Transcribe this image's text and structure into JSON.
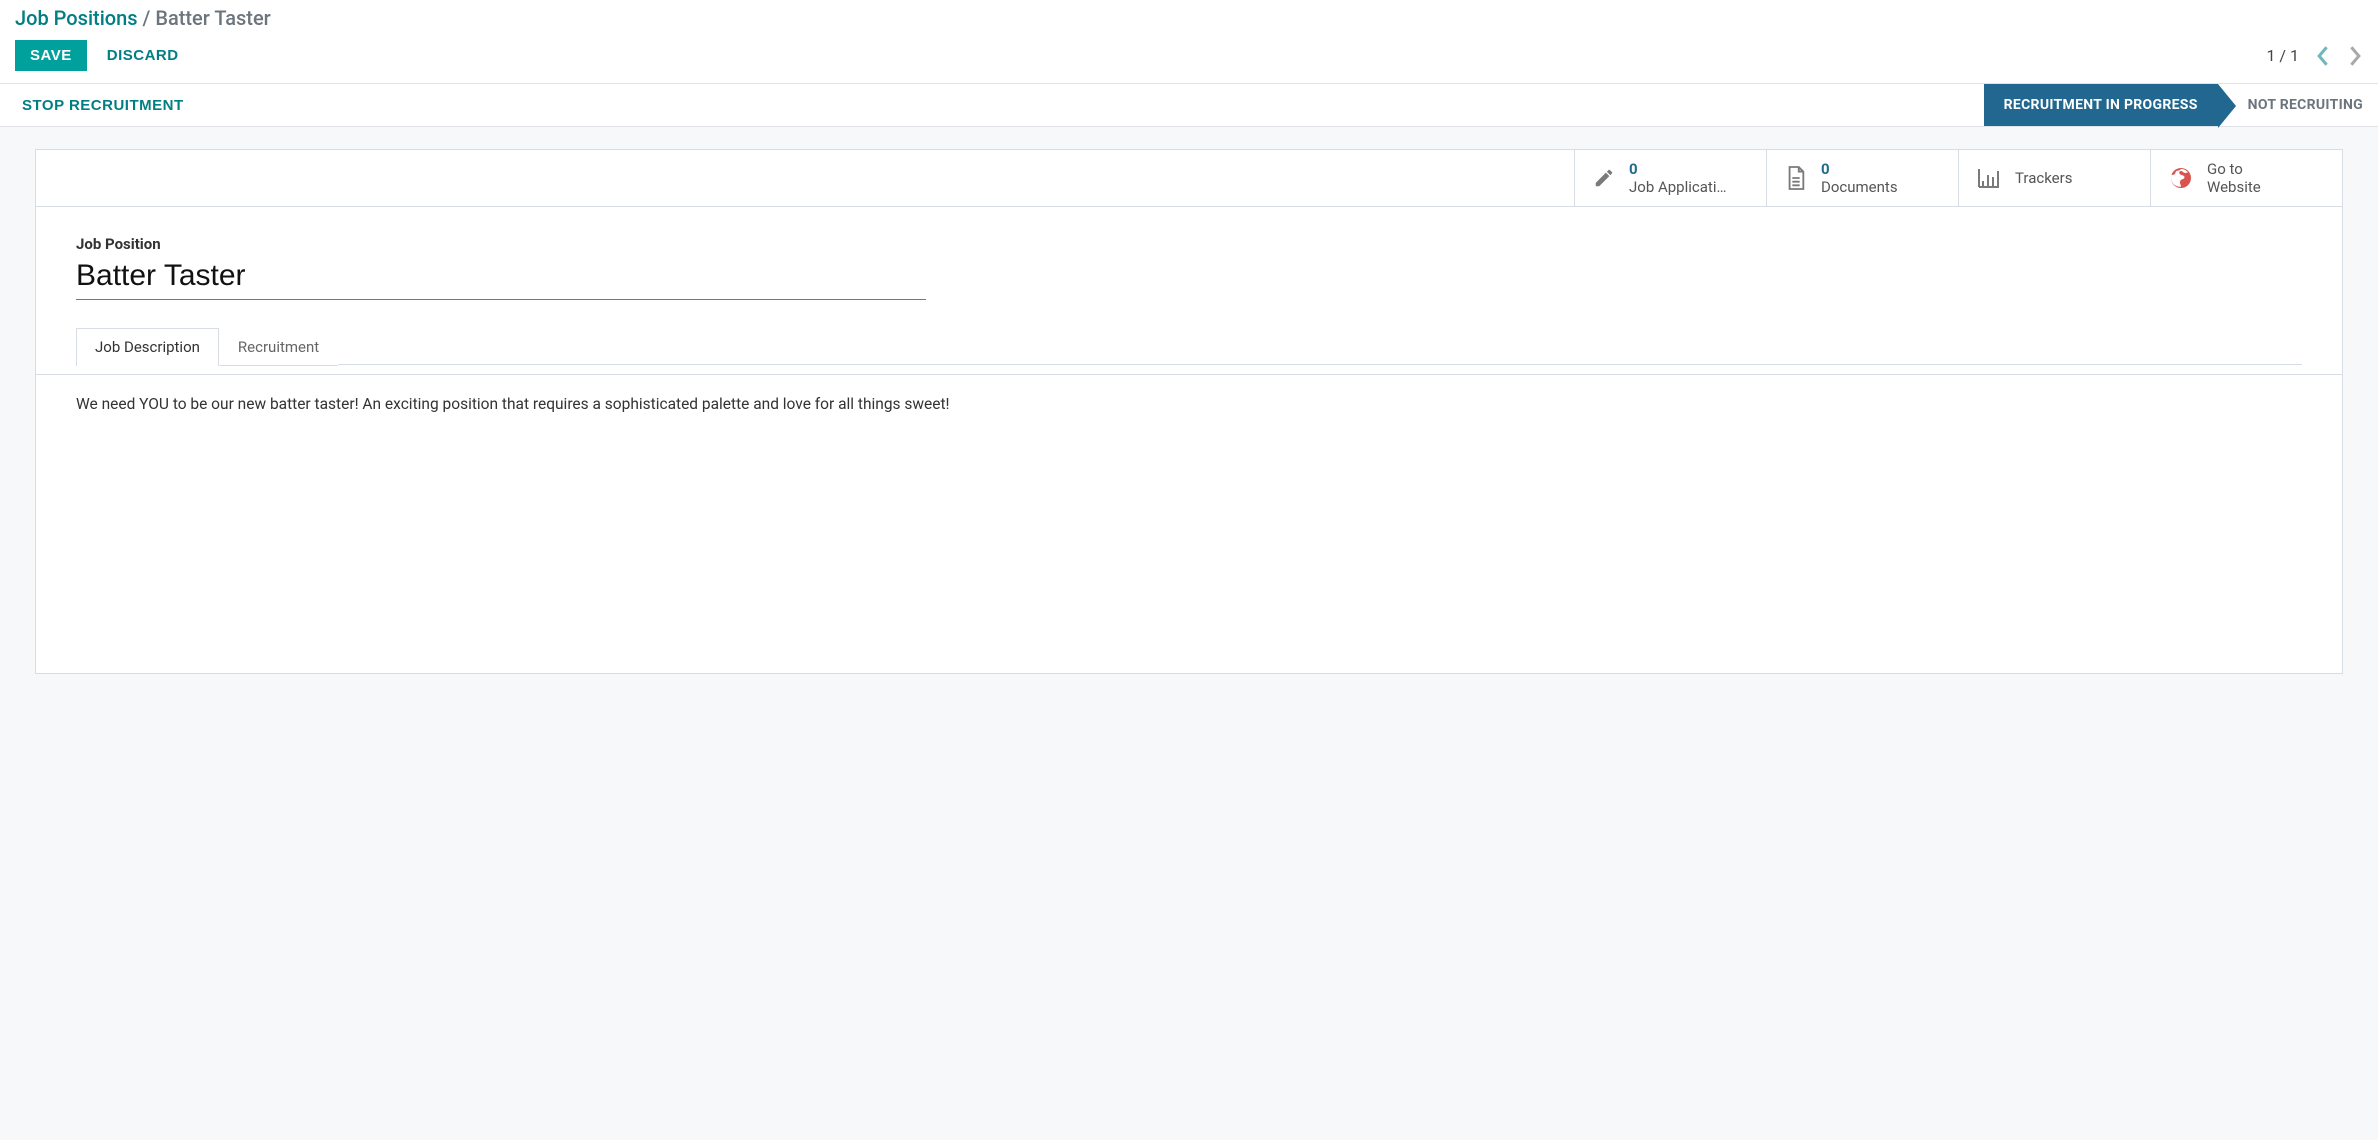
{
  "breadcrumb": {
    "root": "Job Positions",
    "separator": " / ",
    "current": "Batter Taster"
  },
  "actions": {
    "save": "SAVE",
    "discard": "DISCARD"
  },
  "pager": {
    "text": "1 / 1"
  },
  "status": {
    "stop_button": "STOP RECRUITMENT",
    "active_stage": "RECRUITMENT IN PROGRESS",
    "inactive_stage": "NOT RECRUITING"
  },
  "stats": {
    "applications": {
      "count": "0",
      "label": "Job Applicati…"
    },
    "documents": {
      "count": "0",
      "label": "Documents"
    },
    "trackers": {
      "label": "Trackers"
    },
    "website": {
      "line1": "Go to",
      "line2": "Website"
    }
  },
  "form": {
    "field_label": "Job Position",
    "title_value": "Batter Taster"
  },
  "tabs": {
    "description": "Job Description",
    "recruitment": "Recruitment"
  },
  "description_text": "We need YOU to be our new batter taster! An exciting position that requires a sophisticated palette and love for all things sweet!"
}
